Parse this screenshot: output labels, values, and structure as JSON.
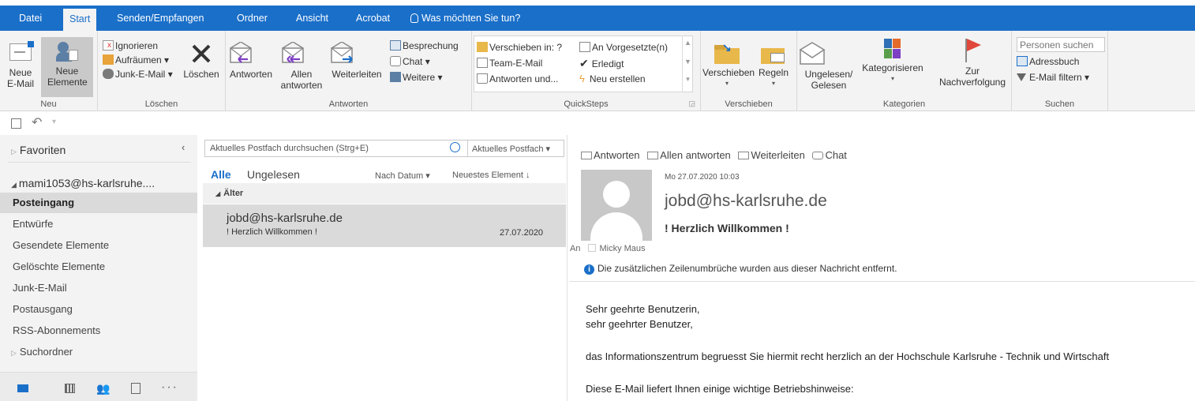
{
  "tabs": [
    "Datei",
    "Start",
    "Senden/Empfangen",
    "Ordner",
    "Ansicht",
    "Acrobat"
  ],
  "tell_me": "Was möchten Sie tun?",
  "ribbon": {
    "neu": {
      "new_email": "Neue E-Mail",
      "new_items": "Neue Elemente",
      "label": "Neu"
    },
    "loeschen": {
      "ignore": "Ignorieren",
      "cleanup": "Aufräumen",
      "junk": "Junk-E-Mail",
      "delete": "Löschen",
      "label": "Löschen"
    },
    "antworten": {
      "reply": "Antworten",
      "reply_all_1": "Allen",
      "reply_all_2": "antworten",
      "forward": "Weiterleiten",
      "meeting": "Besprechung",
      "chat": "Chat",
      "more": "Weitere",
      "label": "Antworten"
    },
    "quicksteps": {
      "move_to": "Verschieben in: ?",
      "team": "Team-E-Mail",
      "reply_delete": "Antworten und...",
      "to_manager": "An Vorgesetzte(n)",
      "done": "Erledigt",
      "create": "Neu erstellen",
      "label": "QuickSteps"
    },
    "verschieben": {
      "move": "Verschieben",
      "rules": "Regeln",
      "label": "Verschieben"
    },
    "kategorien": {
      "unread_1": "Ungelesen/",
      "unread_2": "Gelesen",
      "categorize": "Kategorisieren",
      "followup_1": "Zur",
      "followup_2": "Nachverfolgung",
      "label": "Kategorien"
    },
    "suchen": {
      "people_placeholder": "Personen suchen",
      "address_book": "Adressbuch",
      "filter": "E-Mail filtern",
      "label": "Suchen"
    }
  },
  "nav": {
    "favorites": "Favoriten",
    "account": "mami1053@hs-karlsruhe....",
    "folders": [
      "Posteingang",
      "Entwürfe",
      "Gesendete Elemente",
      "Gelöschte Elemente",
      "Junk-E-Mail",
      "Postausgang",
      "RSS-Abonnements"
    ],
    "search_folders": "Suchordner"
  },
  "list": {
    "search_placeholder": "Aktuelles Postfach durchsuchen (Strg+E)",
    "scope": "Aktuelles Postfach",
    "filter_all": "Alle",
    "filter_unread": "Ungelesen",
    "sort_by": "Nach Datum",
    "sort_order": "Neuestes Element",
    "group": "Älter",
    "item": {
      "sender": "jobd@hs-karlsruhe.de",
      "subject": "! Herzlich Willkommen !",
      "date": "27.07.2020"
    }
  },
  "reading": {
    "actions": [
      "Antworten",
      "Allen antworten",
      "Weiterleiten",
      "Chat"
    ],
    "datetime": "Mo 27.07.2020 10:03",
    "sender": "jobd@hs-karlsruhe.de",
    "subject": "! Herzlich Willkommen !",
    "to_label": "An",
    "recipient": "Micky Maus",
    "info": "Die zusätzlichen Zeilenumbrüche wurden aus dieser Nachricht entfernt.",
    "body": [
      "Sehr geehrte Benutzerin,",
      "sehr geehrter Benutzer,",
      "das Informationszentrum begruesst Sie hiermit recht herzlich an der Hochschule Karlsruhe - Technik und Wirtschaft",
      "Diese E-Mail liefert Ihnen einige wichtige Betriebshinweise:"
    ]
  },
  "colors": {
    "accent": "#1a6fc9",
    "ribbon_bg": "#f3f3f3",
    "selected": "#dadada"
  }
}
